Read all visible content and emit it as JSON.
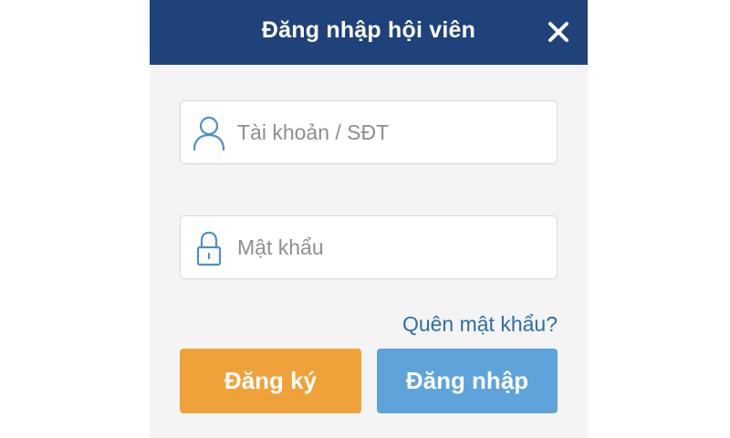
{
  "dialog": {
    "title": "Đăng nhập hội viên",
    "close_icon": "close-icon"
  },
  "form": {
    "username": {
      "placeholder": "Tài khoản / SĐT",
      "value": "",
      "icon": "user-icon"
    },
    "password": {
      "placeholder": "Mật khẩu",
      "value": "",
      "icon": "lock-icon"
    },
    "forgot_password_label": "Quên mật khẩu?",
    "register_label": "Đăng ký",
    "login_label": "Đăng nhập"
  },
  "colors": {
    "header_bg": "#1e4279",
    "register_bg": "#f0a23a",
    "login_bg": "#5ea3d9",
    "link": "#2e6ea6",
    "icon": "#4d8fc9"
  }
}
